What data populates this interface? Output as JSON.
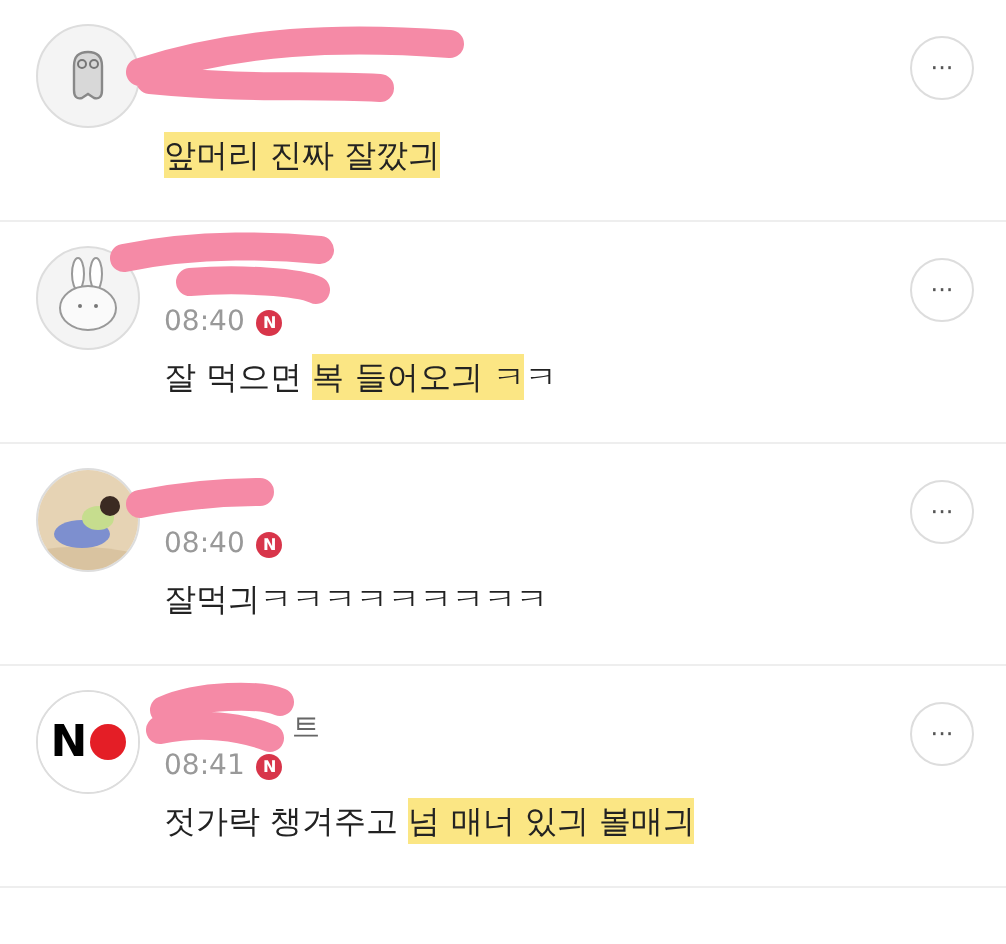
{
  "comments": [
    {
      "avatar": {
        "kind": "ghost"
      },
      "segments": [
        {
          "text": "앞머리 진짜 잘깠긔",
          "highlighted": true
        }
      ]
    },
    {
      "avatar": {
        "kind": "bunny"
      },
      "time": "08:40",
      "badge": "N",
      "segments": [
        {
          "text": "잘 먹으면 ",
          "highlighted": false
        },
        {
          "text": "복 들어오긔 ㅋ",
          "highlighted": true
        },
        {
          "text": "ㅋ",
          "highlighted": false
        }
      ]
    },
    {
      "avatar": {
        "kind": "picture"
      },
      "time": "08:40",
      "badge": "N",
      "segments": [
        {
          "text": "잘먹긔ㅋㅋㅋㅋㅋㅋㅋㅋㅋ",
          "highlighted": false
        }
      ]
    },
    {
      "avatar": {
        "kind": "no-sign",
        "label": "N"
      },
      "name_visible": "트",
      "time": "08:41",
      "badge": "N",
      "segments": [
        {
          "text": "젓가락 챙겨주고 ",
          "highlighted": false
        },
        {
          "text": "넘 매너 있긔 볼매긔",
          "highlighted": true
        }
      ]
    }
  ],
  "more_label": "···"
}
